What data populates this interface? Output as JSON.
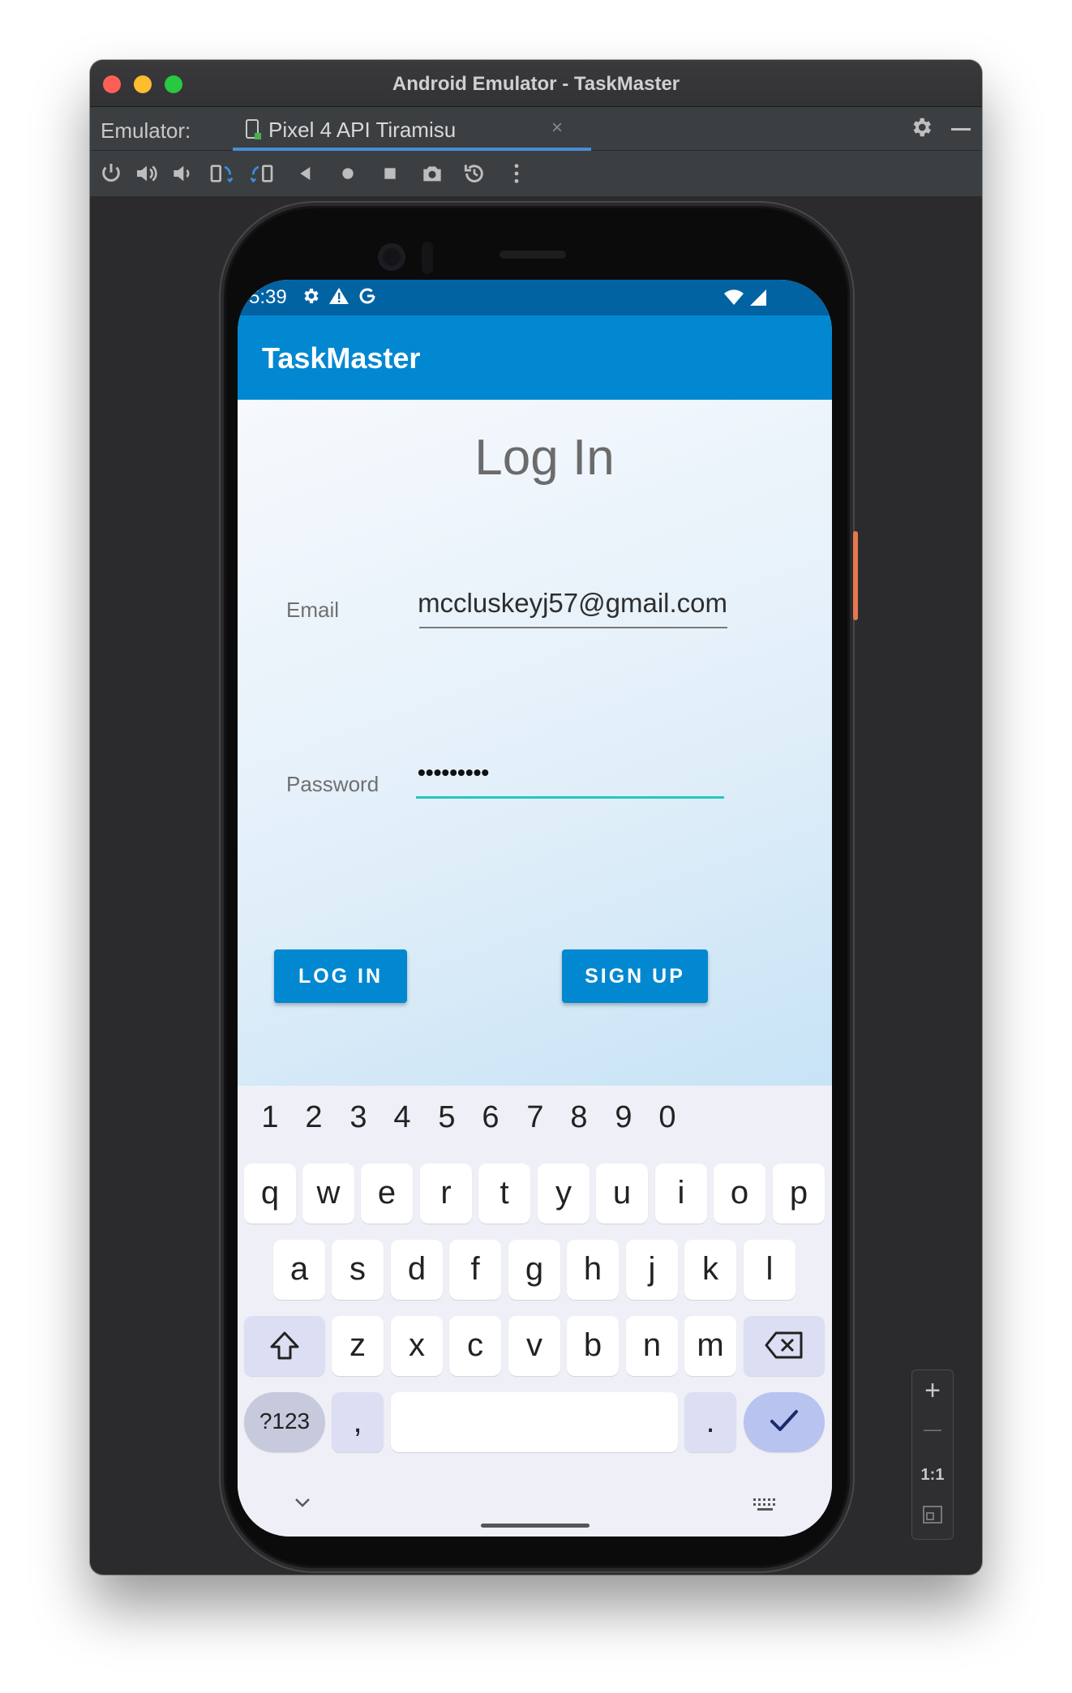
{
  "window": {
    "title": "Android Emulator - TaskMaster",
    "emulator_label": "Emulator:",
    "device_tab": "Pixel 4 API Tiramisu",
    "tab_close": "×"
  },
  "toolbar_icons": [
    "power-icon",
    "volume-up-icon",
    "volume-down-icon",
    "rotate-left-icon",
    "rotate-right-icon",
    "back-icon",
    "home-icon",
    "overview-icon",
    "screenshot-icon",
    "snapshot-icon",
    "more-icon"
  ],
  "zoom_panel": {
    "zoom_in": "+",
    "zoom_out": "—",
    "actual_size": "1:1"
  },
  "status_bar": {
    "time": "5:39"
  },
  "app": {
    "title": "TaskMaster"
  },
  "login": {
    "heading": "Log In",
    "email_label": "Email",
    "email_value": "mccluskeyj57@gmail.com",
    "password_label": "Password",
    "password_value": "•••••••••",
    "login_button": "LOG IN",
    "signup_button": "SIGN UP"
  },
  "keyboard": {
    "numbers": [
      "1",
      "2",
      "3",
      "4",
      "5",
      "6",
      "7",
      "8",
      "9",
      "0"
    ],
    "row1": [
      "q",
      "w",
      "e",
      "r",
      "t",
      "y",
      "u",
      "i",
      "o",
      "p"
    ],
    "row2": [
      "a",
      "s",
      "d",
      "f",
      "g",
      "h",
      "j",
      "k",
      "l"
    ],
    "row3": [
      "z",
      "x",
      "c",
      "v",
      "b",
      "n",
      "m"
    ],
    "symbols_key": "?123",
    "comma_key": ",",
    "period_key": "."
  },
  "colors": {
    "status_bar": "#0263a3",
    "app_bar": "#0288d1",
    "button": "#0288d1",
    "focused_underline": "#26c6c0"
  }
}
